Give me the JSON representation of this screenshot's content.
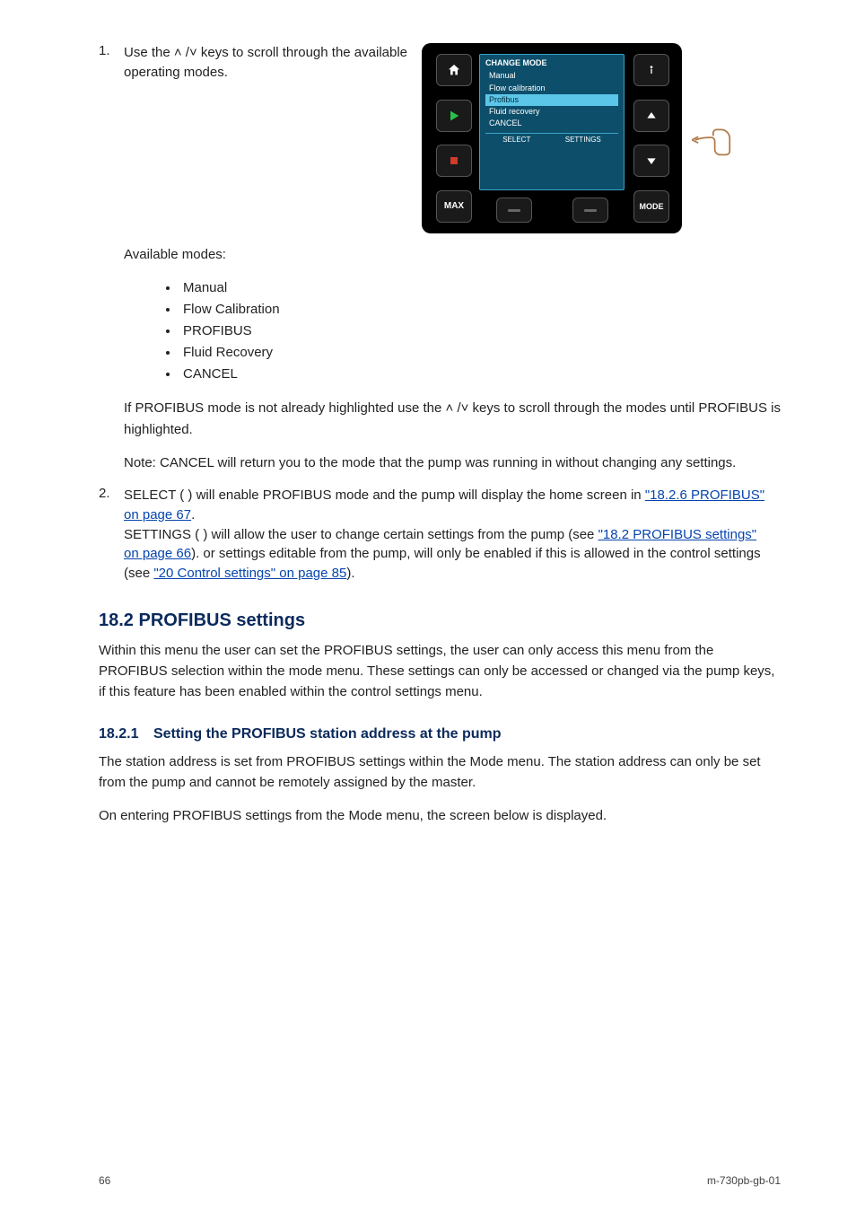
{
  "step": {
    "num": "1.",
    "text": "Use the ˄ /˅ keys to scroll through the available operating modes."
  },
  "device": {
    "lcd": {
      "title": "CHANGE MODE",
      "items": [
        "Manual",
        "Flow calibration",
        "Profibus",
        "Fluid recovery",
        "CANCEL"
      ],
      "selected_index": 2,
      "soft_left": "SELECT",
      "soft_right": "SETTINGS"
    },
    "keys": {
      "max": "MAX",
      "mode": "MODE"
    }
  },
  "modes_intro": "Available modes:",
  "modes": [
    "Manual",
    "Flow Calibration",
    "PROFIBUS",
    "Fluid Recovery",
    "CANCEL"
  ],
  "body1": "If PROFIBUS mode is not already highlighted use the ˄ /˅ keys to scroll through the modes until PROFIBUS is highlighted.",
  "body2": "Note: CANCEL will return you to the mode that the pump was running in without changing any settings.",
  "step2": {
    "num": "2.",
    "text_a": "SELECT (    ) will enable PROFIBUS mode and the pump will display the home screen in",
    "text_b": "SETTINGS (    ) will allow the user to change certain settings from the pump (see",
    "text_c": " or settings editable from the pump, will only be enabled if this is allowed in the control settings (see "
  },
  "links": {
    "a": "\"18.2.6 PROFIBUS\" on page 67",
    "b": "\"18.2 PROFIBUS settings\" on page 66",
    "c": "\"20 Control settings\" on page 85"
  },
  "section": {
    "num": "18.2",
    "title": "PROFIBUS settings"
  },
  "section_intro": "Within this menu the user can set the PROFIBUS settings, the user can only access this menu from the PROFIBUS selection within the mode menu. These settings can only be accessed or changed via the pump keys, if this feature has been enabled within the control settings menu.",
  "sub": {
    "num": "18.2.1",
    "title": "Setting the PROFIBUS station address at the pump"
  },
  "sub_body1": "The station address is set from PROFIBUS settings within the Mode menu. The station address can only be set from the pump and cannot be remotely assigned by the master.",
  "sub_body2": "On entering PROFIBUS settings from the Mode menu, the screen below is displayed.",
  "footer": {
    "left": "66",
    "right": "m-730pb-gb-01"
  }
}
